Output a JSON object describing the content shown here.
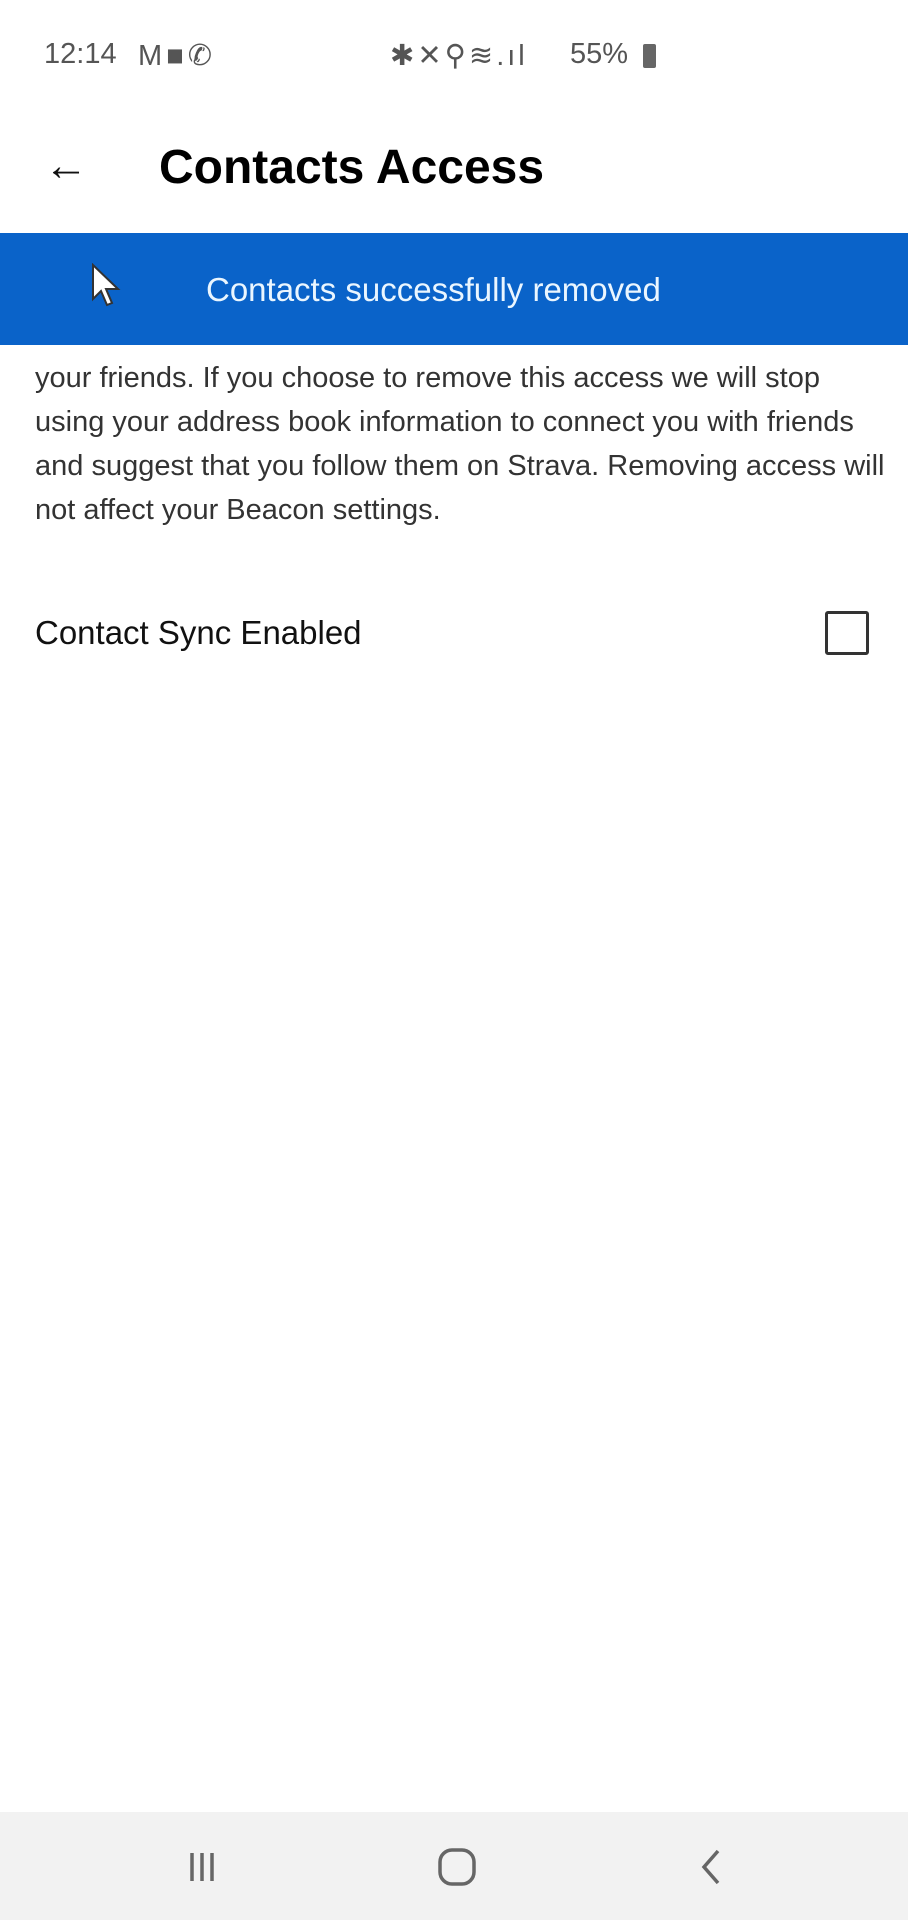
{
  "status_bar": {
    "time": "12:14",
    "left_icons": [
      "gmail-icon",
      "video-icon",
      "phone-icon"
    ],
    "right_icons": [
      "bluetooth-icon",
      "mute-icon",
      "location-icon",
      "wifi-icon",
      "signal-icon"
    ],
    "battery": "55%"
  },
  "app_bar": {
    "title": "Contacts Access",
    "back_icon": "arrow-left-icon"
  },
  "snackbar": {
    "message": "Contacts successfully removed",
    "color": "#0A63C9"
  },
  "description": "your friends. If you choose to remove this access we will stop using your address book information to connect you with friends and suggest that you follow them on Strava. Removing access will not affect your Beacon settings.",
  "settings": {
    "contact_sync": {
      "label": "Contact Sync Enabled",
      "checked": false
    }
  },
  "nav_bar": {
    "buttons": [
      "recents-icon",
      "home-icon",
      "back-icon"
    ]
  }
}
